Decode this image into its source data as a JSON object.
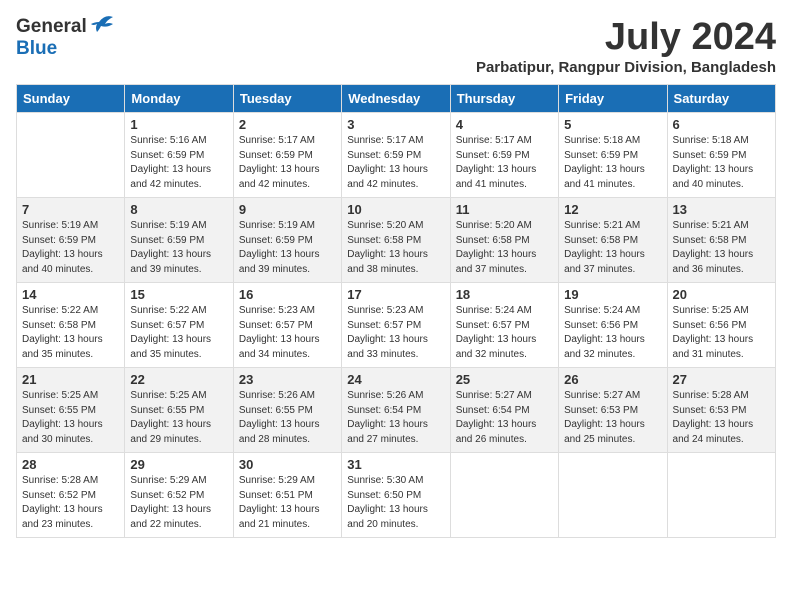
{
  "logo": {
    "general": "General",
    "blue": "Blue"
  },
  "title": "July 2024",
  "location": "Parbatipur, Rangpur Division, Bangladesh",
  "headers": [
    "Sunday",
    "Monday",
    "Tuesday",
    "Wednesday",
    "Thursday",
    "Friday",
    "Saturday"
  ],
  "weeks": [
    [
      {
        "num": "",
        "info": ""
      },
      {
        "num": "1",
        "info": "Sunrise: 5:16 AM\nSunset: 6:59 PM\nDaylight: 13 hours\nand 42 minutes."
      },
      {
        "num": "2",
        "info": "Sunrise: 5:17 AM\nSunset: 6:59 PM\nDaylight: 13 hours\nand 42 minutes."
      },
      {
        "num": "3",
        "info": "Sunrise: 5:17 AM\nSunset: 6:59 PM\nDaylight: 13 hours\nand 42 minutes."
      },
      {
        "num": "4",
        "info": "Sunrise: 5:17 AM\nSunset: 6:59 PM\nDaylight: 13 hours\nand 41 minutes."
      },
      {
        "num": "5",
        "info": "Sunrise: 5:18 AM\nSunset: 6:59 PM\nDaylight: 13 hours\nand 41 minutes."
      },
      {
        "num": "6",
        "info": "Sunrise: 5:18 AM\nSunset: 6:59 PM\nDaylight: 13 hours\nand 40 minutes."
      }
    ],
    [
      {
        "num": "7",
        "info": "Sunrise: 5:19 AM\nSunset: 6:59 PM\nDaylight: 13 hours\nand 40 minutes."
      },
      {
        "num": "8",
        "info": "Sunrise: 5:19 AM\nSunset: 6:59 PM\nDaylight: 13 hours\nand 39 minutes."
      },
      {
        "num": "9",
        "info": "Sunrise: 5:19 AM\nSunset: 6:59 PM\nDaylight: 13 hours\nand 39 minutes."
      },
      {
        "num": "10",
        "info": "Sunrise: 5:20 AM\nSunset: 6:58 PM\nDaylight: 13 hours\nand 38 minutes."
      },
      {
        "num": "11",
        "info": "Sunrise: 5:20 AM\nSunset: 6:58 PM\nDaylight: 13 hours\nand 37 minutes."
      },
      {
        "num": "12",
        "info": "Sunrise: 5:21 AM\nSunset: 6:58 PM\nDaylight: 13 hours\nand 37 minutes."
      },
      {
        "num": "13",
        "info": "Sunrise: 5:21 AM\nSunset: 6:58 PM\nDaylight: 13 hours\nand 36 minutes."
      }
    ],
    [
      {
        "num": "14",
        "info": "Sunrise: 5:22 AM\nSunset: 6:58 PM\nDaylight: 13 hours\nand 35 minutes."
      },
      {
        "num": "15",
        "info": "Sunrise: 5:22 AM\nSunset: 6:57 PM\nDaylight: 13 hours\nand 35 minutes."
      },
      {
        "num": "16",
        "info": "Sunrise: 5:23 AM\nSunset: 6:57 PM\nDaylight: 13 hours\nand 34 minutes."
      },
      {
        "num": "17",
        "info": "Sunrise: 5:23 AM\nSunset: 6:57 PM\nDaylight: 13 hours\nand 33 minutes."
      },
      {
        "num": "18",
        "info": "Sunrise: 5:24 AM\nSunset: 6:57 PM\nDaylight: 13 hours\nand 32 minutes."
      },
      {
        "num": "19",
        "info": "Sunrise: 5:24 AM\nSunset: 6:56 PM\nDaylight: 13 hours\nand 32 minutes."
      },
      {
        "num": "20",
        "info": "Sunrise: 5:25 AM\nSunset: 6:56 PM\nDaylight: 13 hours\nand 31 minutes."
      }
    ],
    [
      {
        "num": "21",
        "info": "Sunrise: 5:25 AM\nSunset: 6:55 PM\nDaylight: 13 hours\nand 30 minutes."
      },
      {
        "num": "22",
        "info": "Sunrise: 5:25 AM\nSunset: 6:55 PM\nDaylight: 13 hours\nand 29 minutes."
      },
      {
        "num": "23",
        "info": "Sunrise: 5:26 AM\nSunset: 6:55 PM\nDaylight: 13 hours\nand 28 minutes."
      },
      {
        "num": "24",
        "info": "Sunrise: 5:26 AM\nSunset: 6:54 PM\nDaylight: 13 hours\nand 27 minutes."
      },
      {
        "num": "25",
        "info": "Sunrise: 5:27 AM\nSunset: 6:54 PM\nDaylight: 13 hours\nand 26 minutes."
      },
      {
        "num": "26",
        "info": "Sunrise: 5:27 AM\nSunset: 6:53 PM\nDaylight: 13 hours\nand 25 minutes."
      },
      {
        "num": "27",
        "info": "Sunrise: 5:28 AM\nSunset: 6:53 PM\nDaylight: 13 hours\nand 24 minutes."
      }
    ],
    [
      {
        "num": "28",
        "info": "Sunrise: 5:28 AM\nSunset: 6:52 PM\nDaylight: 13 hours\nand 23 minutes."
      },
      {
        "num": "29",
        "info": "Sunrise: 5:29 AM\nSunset: 6:52 PM\nDaylight: 13 hours\nand 22 minutes."
      },
      {
        "num": "30",
        "info": "Sunrise: 5:29 AM\nSunset: 6:51 PM\nDaylight: 13 hours\nand 21 minutes."
      },
      {
        "num": "31",
        "info": "Sunrise: 5:30 AM\nSunset: 6:50 PM\nDaylight: 13 hours\nand 20 minutes."
      },
      {
        "num": "",
        "info": ""
      },
      {
        "num": "",
        "info": ""
      },
      {
        "num": "",
        "info": ""
      }
    ]
  ]
}
